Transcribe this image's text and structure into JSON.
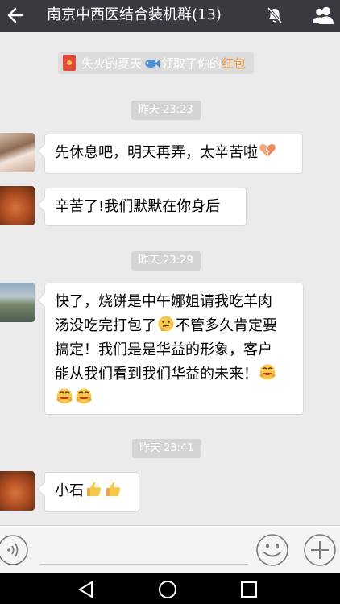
{
  "header": {
    "title": "南京中西医结合装机群(13)"
  },
  "system_notice": {
    "name": "失火的夏天",
    "text": "领取了你的",
    "link": "红包"
  },
  "messages": [
    {
      "type": "time",
      "text": "昨天 23:23"
    },
    {
      "type": "text",
      "avatar": "avatar-girl",
      "text": "先休息吧，明天再弄，太辛苦啦"
    },
    {
      "type": "text",
      "avatar": "avatar-stone",
      "text": "辛苦了!我们默默在你身后"
    },
    {
      "type": "time",
      "text": "昨天 23:29"
    },
    {
      "type": "text",
      "avatar": "avatar-road",
      "lines": [
        "快了，烧饼是中午娜姐请我吃羊肉",
        "汤没吃完打包了",
        "不管多久肯定要",
        "搞定！我们是是华益的形象，客户",
        "能从我们看到我们华益的未来！"
      ]
    },
    {
      "type": "time",
      "text": "昨天 23:41"
    },
    {
      "type": "text",
      "avatar": "avatar-stone",
      "text": "小石"
    }
  ],
  "icons": {
    "back": "back-arrow-icon",
    "mute": "mute-bell-icon",
    "members": "group-members-icon",
    "voice": "voice-input-icon",
    "emoji": "emoji-icon",
    "more": "add-more-icon",
    "nav_back": "nav-back-icon",
    "nav_home": "nav-home-icon",
    "nav_recent": "nav-recent-icon",
    "broken_heart": "broken-heart-icon",
    "thinking": "thinking-face-icon",
    "hug": "hugging-face-icon",
    "thumbs_up": "thumbs-up-icon",
    "fish": "fish-icon",
    "red_packet": "red-packet-icon"
  },
  "colors": {
    "topbar": "#393a3f",
    "chat_bg": "#ebebeb",
    "link": "#f09b3a"
  }
}
